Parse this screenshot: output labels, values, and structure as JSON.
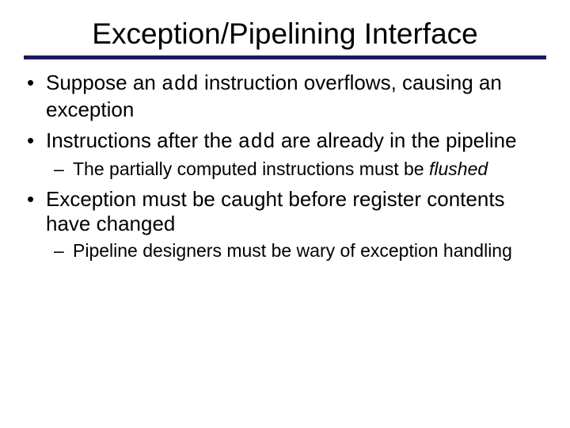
{
  "title": "Exception/Pipelining Interface",
  "bullets": {
    "b1_a": "Suppose an ",
    "b1_code": "add",
    "b1_b": " instruction overflows, causing an exception",
    "b2_a": "Instructions after the ",
    "b2_code": "add",
    "b2_b": " are already in the pipeline",
    "b2_sub_a": "The partially computed instructions must be ",
    "b2_sub_ital": "flushed",
    "b3": "Exception must be caught before register contents have changed",
    "b3_sub": "Pipeline designers must be wary of exception handling"
  }
}
